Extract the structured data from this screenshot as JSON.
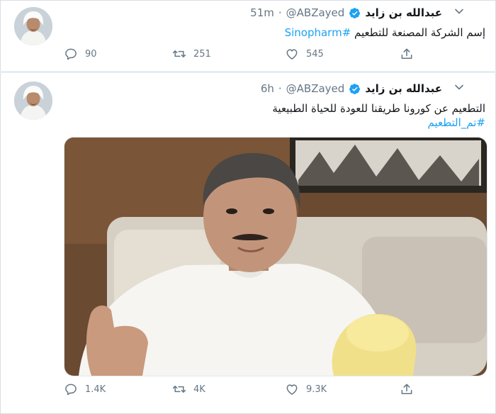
{
  "tweets": [
    {
      "name": "عبدالله بن زايد",
      "handle": "@ABZayed",
      "separator": "·",
      "time": "51m",
      "text_prefix": "إسم الشركة المصنعة للتطعيم ",
      "text_hashtag": "#Sinopharm",
      "reply_count": "90",
      "retweet_count": "251",
      "like_count": "545"
    },
    {
      "name": "عبدالله بن زايد",
      "handle": "@ABZayed",
      "separator": "·",
      "time": "6h",
      "text_line1": "التطعيم عن كورونا طريقنا للعودة للحياة الطبيعية",
      "text_hashtag": "#تم_التطعيم",
      "reply_count": "1.4K",
      "retweet_count": "4K",
      "like_count": "9.3K"
    }
  ],
  "colors": {
    "accent": "#1da1f2",
    "secondary_text": "#657786",
    "separator": "#e6ecf0"
  },
  "icons": [
    "verified-badge-icon",
    "chevron-down-icon",
    "reply-icon",
    "retweet-icon",
    "like-icon",
    "share-icon"
  ]
}
